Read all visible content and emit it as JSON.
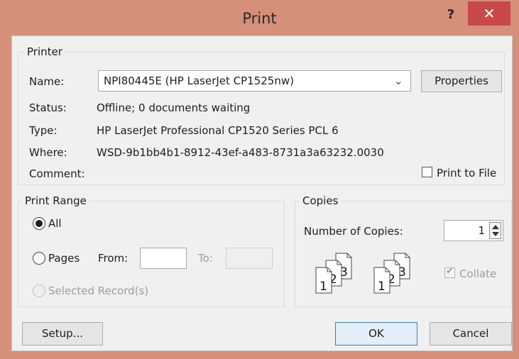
{
  "window": {
    "title": "Print",
    "help_glyph": "?",
    "close_glyph": "✕"
  },
  "printer": {
    "group_label": "Printer",
    "name_label": "Name:",
    "name_value": "NPI80445E (HP LaserJet CP1525nw)",
    "properties_label": "Properties",
    "status_label": "Status:",
    "status_value": "Offline; 0 documents waiting",
    "type_label": "Type:",
    "type_value": "HP LaserJet Professional CP1520 Series PCL 6",
    "where_label": "Where:",
    "where_value": "WSD-9b1bb4b1-8912-43ef-a483-8731a3a63232.0030",
    "comment_label": "Comment:",
    "comment_value": "",
    "print_to_file_label": "Print to File",
    "print_to_file_checked": false
  },
  "print_range": {
    "group_label": "Print Range",
    "all_label": "All",
    "all_selected": true,
    "pages_label": "Pages",
    "from_label": "From:",
    "from_value": "",
    "to_label": "To:",
    "to_value": "",
    "selected_records_label": "Selected Record(s)"
  },
  "copies": {
    "group_label": "Copies",
    "number_label": "Number of Copies:",
    "number_value": "1",
    "collate_label": "Collate",
    "collate_checked": true,
    "icon_digits": [
      "1",
      "2",
      "3"
    ]
  },
  "buttons": {
    "setup": "Setup...",
    "ok": "OK",
    "cancel": "Cancel"
  },
  "colors": {
    "title_bar": "#d68f78",
    "close_button": "#c74a48",
    "dialog_bg": "#f0f0f0",
    "default_button_border": "#3c7fb1"
  }
}
